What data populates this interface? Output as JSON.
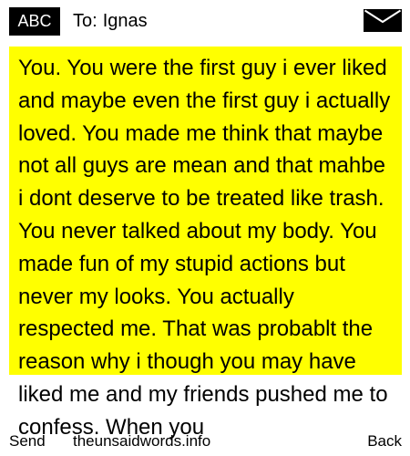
{
  "header": {
    "input_mode": "ABC",
    "recipient_prefix": "To:",
    "recipient_name": "Ignas",
    "icon": "envelope-icon"
  },
  "message": {
    "text": "You. You were the first guy i ever liked and maybe even the first guy i actually loved. You made me think that maybe not all guys are mean and that mahbe i dont deserve to be treated like trash. You never talked about my body. You made fun of my stupid actions but never my looks. You actually respected me. That was probablt the reason why i though you may have liked me and my friends pushed me to confess. When you",
    "highlight_color": "#ffff00"
  },
  "softkeys": {
    "left": "Send",
    "center": "theunsaidwords.info",
    "right": "Back"
  }
}
